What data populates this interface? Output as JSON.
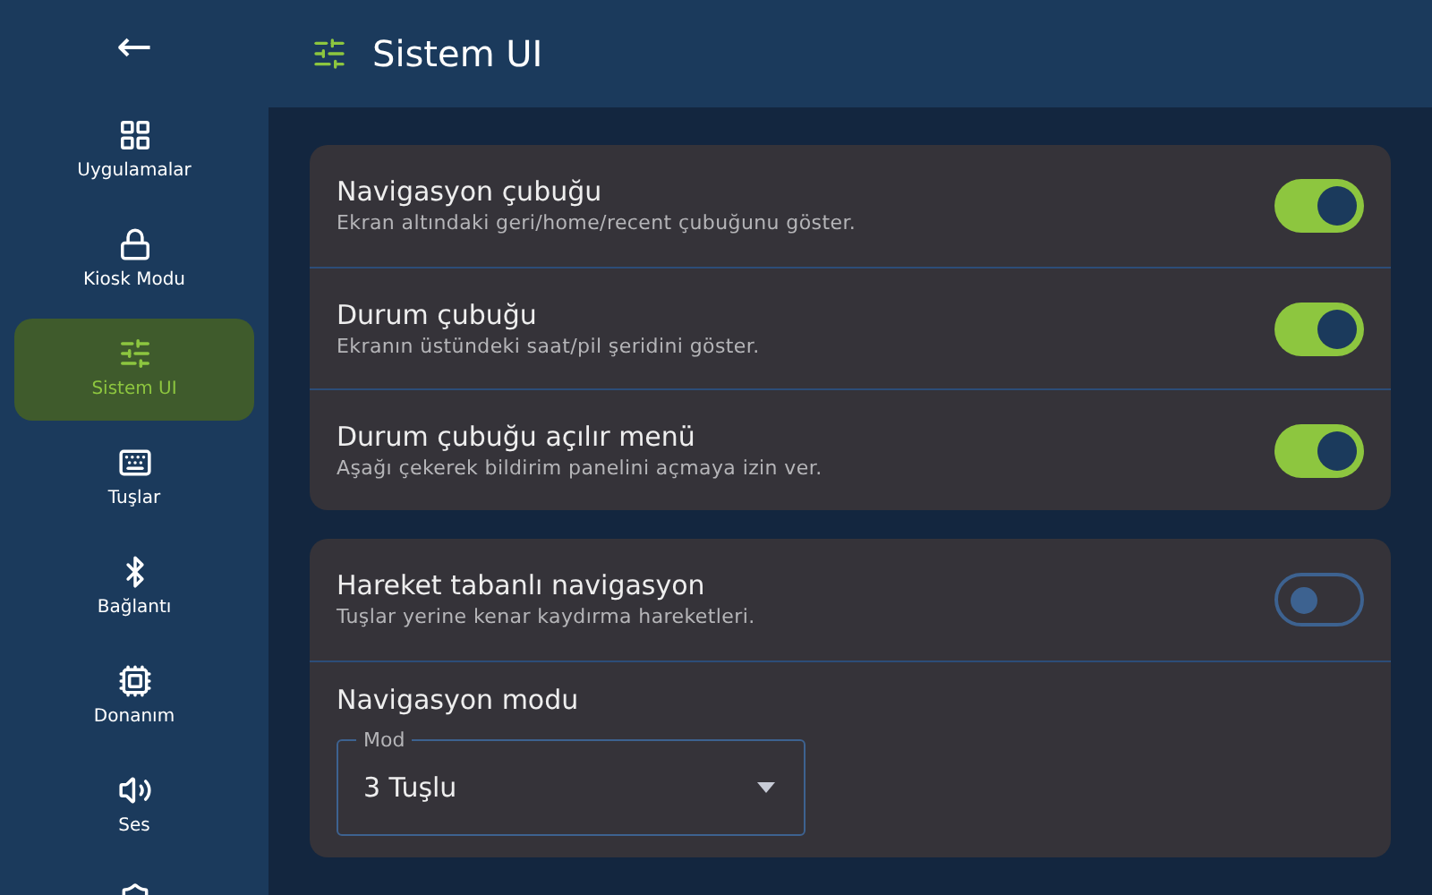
{
  "back_button": {
    "label": "←"
  },
  "header": {
    "title": "Sistem UI"
  },
  "sidebar": {
    "items": [
      {
        "label": "Uygulamalar",
        "selected": false
      },
      {
        "label": "Kiosk Modu",
        "selected": false
      },
      {
        "label": "Sistem UI",
        "selected": true
      },
      {
        "label": "Tuşlar",
        "selected": false
      },
      {
        "label": "Bağlantı",
        "selected": false
      },
      {
        "label": "Donanım",
        "selected": false
      },
      {
        "label": "Ses",
        "selected": false
      },
      {
        "selected": false
      }
    ]
  },
  "cards": [
    {
      "rows": [
        {
          "kind": "toggle",
          "title": "Navigasyon çubuğu",
          "description": "Ekran altındaki geri/home/recent çubuğunu göster.",
          "on": true
        },
        {
          "kind": "toggle",
          "title": "Durum çubuğu",
          "description": "Ekranın üstündeki saat/pil şeridini göster.",
          "on": true
        },
        {
          "kind": "toggle",
          "title": "Durum çubuğu açılır menü",
          "description": "Aşağı çekerek bildirim panelini açmaya izin ver.",
          "on": true
        }
      ]
    },
    {
      "rows": [
        {
          "kind": "toggle",
          "title": "Hareket tabanlı navigasyon",
          "description": "Tuşlar yerine kenar kaydırma hareketleri.",
          "on": false
        },
        {
          "kind": "select",
          "title": "Navigasyon modu",
          "label": "Mod",
          "value": "3 Tuşlu"
        }
      ]
    }
  ]
}
